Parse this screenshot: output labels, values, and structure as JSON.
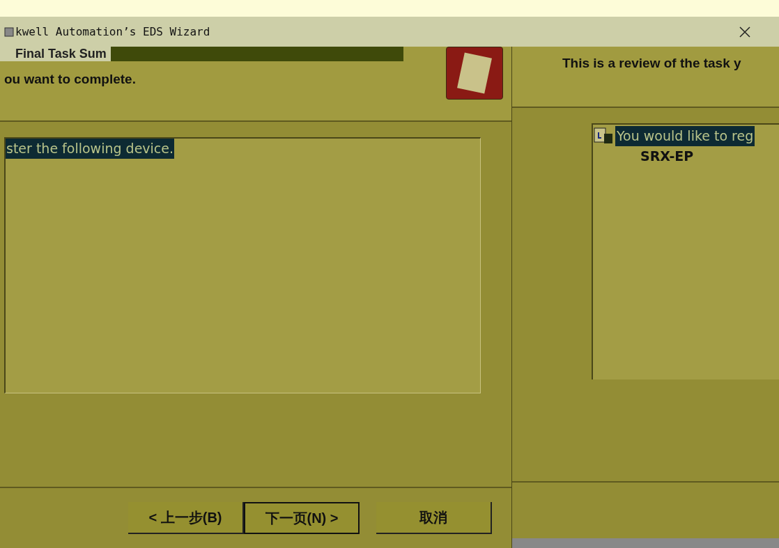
{
  "window": {
    "title": "kwell Automation’s EDS Wizard"
  },
  "left_page": {
    "heading": "Final Task Sum",
    "subheading": "ou want to complete.",
    "list_items": [
      {
        "text": "ster the following device.",
        "selected": true
      }
    ]
  },
  "buttons": [
    {
      "label": "< 上一步(B)",
      "default": false
    },
    {
      "label": "下一页(N) >",
      "default": true
    },
    {
      "label": "取消",
      "default": false
    }
  ],
  "right_page": {
    "subheading": "This is a review of the task y",
    "tree": [
      {
        "text": "You would like to reg",
        "selected": true,
        "children": [
          {
            "text": "SRX-EP",
            "selected": false
          }
        ]
      }
    ]
  }
}
